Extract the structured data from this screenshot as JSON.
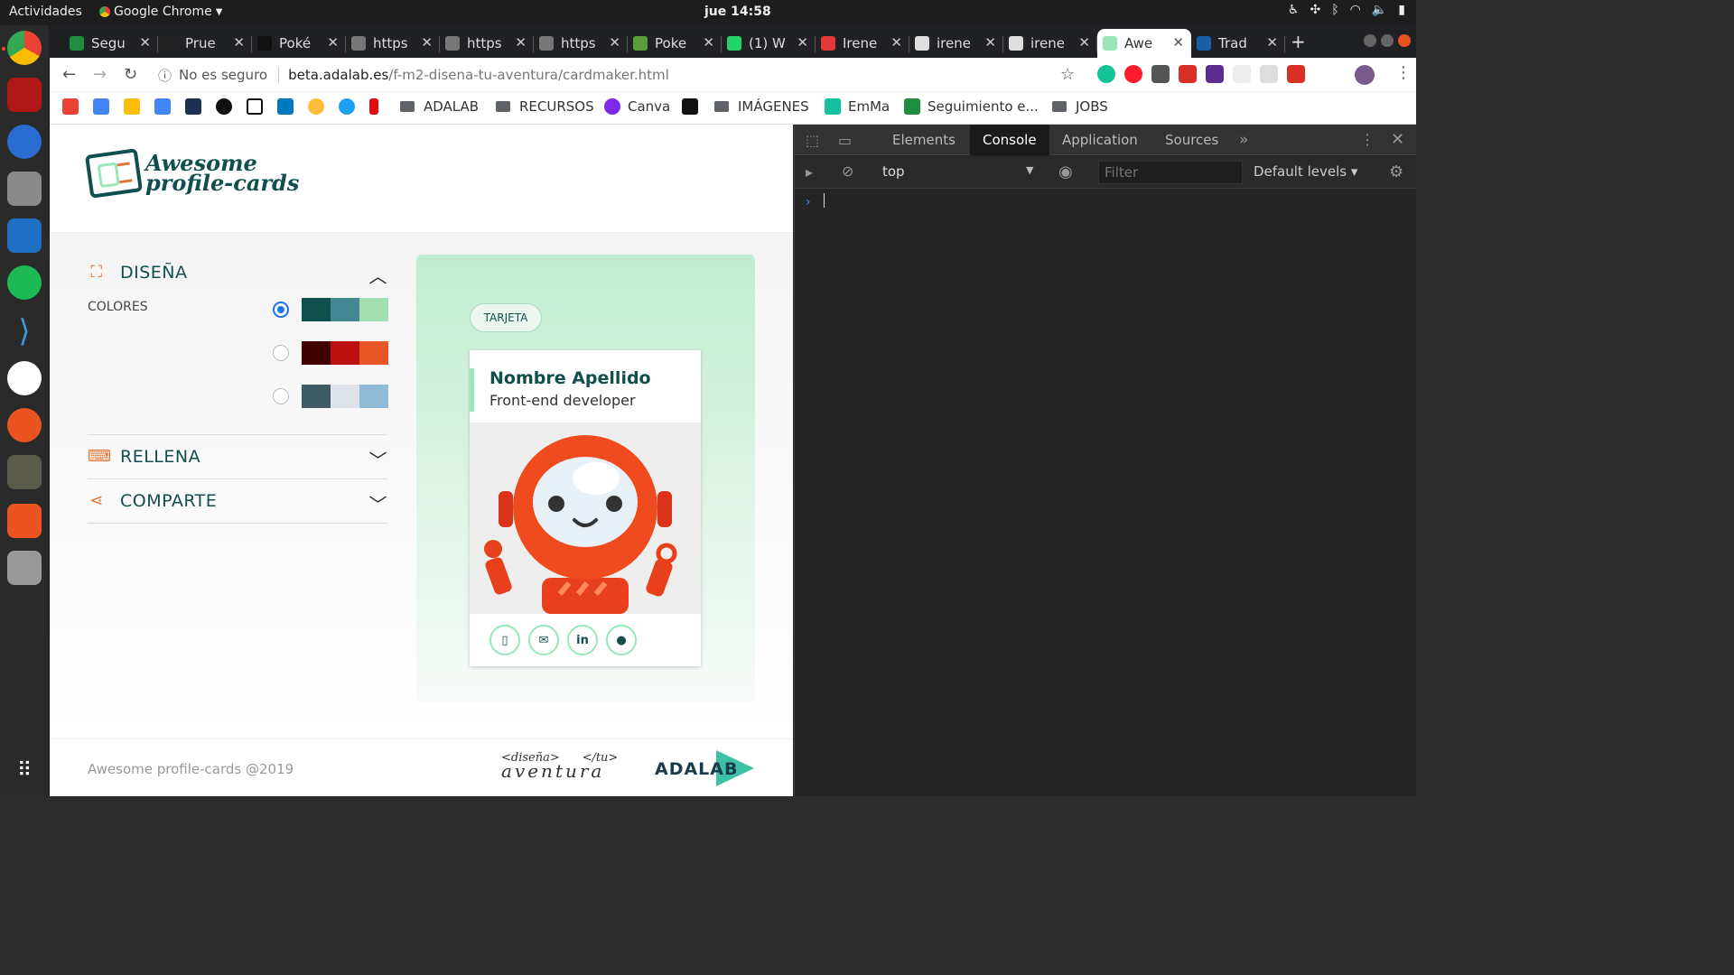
{
  "topbar": {
    "activities": "Actividades",
    "app_name": "Google Chrome",
    "clock": "jue 14:58"
  },
  "tabs": [
    {
      "title": "Segu",
      "color": "#1e8e3e"
    },
    {
      "title": "Prue",
      "color": "#222"
    },
    {
      "title": "Poké",
      "color": "#111"
    },
    {
      "title": "https",
      "color": "#777"
    },
    {
      "title": "https",
      "color": "#777"
    },
    {
      "title": "https",
      "color": "#777"
    },
    {
      "title": "Poke",
      "color": "#5a9e3a"
    },
    {
      "title": "(1) W",
      "color": "#25d366"
    },
    {
      "title": "Irene",
      "color": "#e53935"
    },
    {
      "title": "irene",
      "color": "#ddd"
    },
    {
      "title": "irene",
      "color": "#ddd"
    },
    {
      "title": "Awe",
      "color": "#98e7b9"
    },
    {
      "title": "Trad",
      "color": "#1a5ea8"
    }
  ],
  "address": {
    "security": "No es seguro",
    "host": "beta.adalab.es",
    "path": "/f-m2-disena-tu-aventura/cardmaker.html"
  },
  "bookmarks": {
    "adalab": "ADALAB",
    "recursos": "RECURSOS",
    "canva": "Canva",
    "imagenes": "IMÁGENES",
    "emma": "EmMa",
    "seguimiento": "Seguimiento e...",
    "jobs": "JOBS"
  },
  "page": {
    "logo_line1": "Awesome",
    "logo_line2": "profile-cards",
    "design_title": "DISEÑA",
    "colors_label": "COLORES",
    "palettes": [
      {
        "checked": true,
        "colors": [
          "#114e4e",
          "#438792",
          "#a2deaf"
        ]
      },
      {
        "checked": false,
        "colors": [
          "#420101",
          "#bd1010",
          "#e95626"
        ]
      },
      {
        "checked": false,
        "colors": [
          "#3e5b65",
          "#dfe4ea",
          "#90bad6"
        ]
      }
    ],
    "fill_title": "RELLENA",
    "share_title": "COMPARTE",
    "reset_label": "TARJETA",
    "card_name": "Nombre Apellido",
    "card_job": "Front-end developer",
    "footer_copy": "Awesome profile-cards @2019",
    "footer_aventura_1": "<diseña>",
    "footer_aventura_2": "</tu>",
    "footer_aventura_3": "aventura",
    "footer_brand": "ADALAB"
  },
  "devtools": {
    "tabs": [
      "Elements",
      "Console",
      "Application",
      "Sources"
    ],
    "active_tab": "Console",
    "context": "top",
    "filter_placeholder": "Filter",
    "levels": "Default levels"
  }
}
